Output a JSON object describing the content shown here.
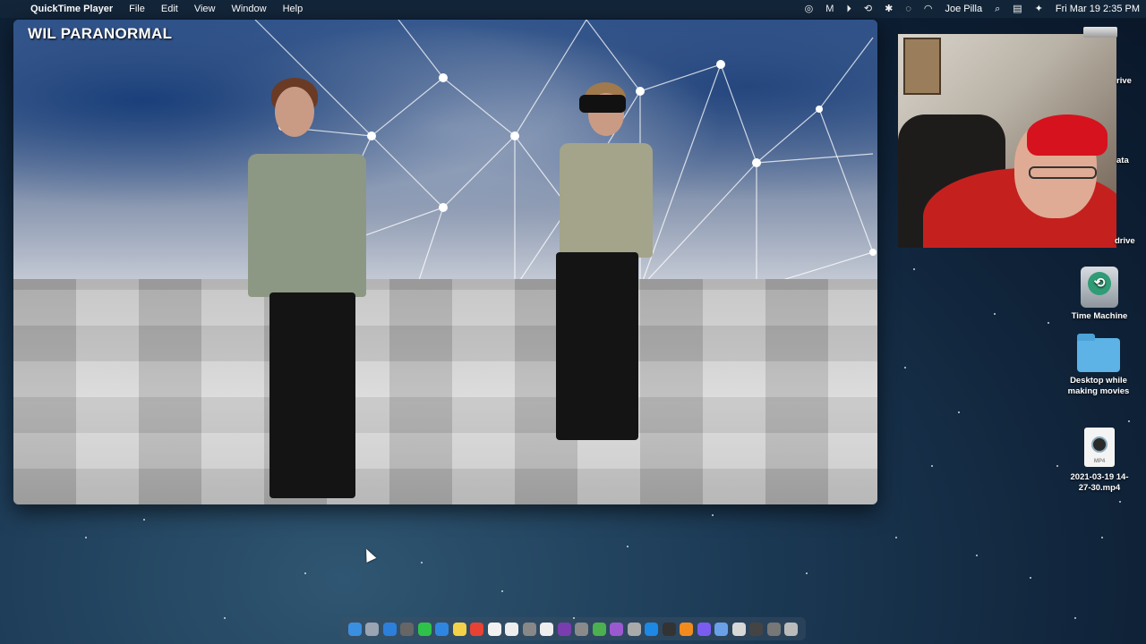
{
  "menubar": {
    "apple_glyph": "",
    "app_name": "QuickTime Player",
    "menus": [
      "File",
      "Edit",
      "View",
      "Window",
      "Help"
    ],
    "user_name": "Joe Pilla",
    "datetime": "Fri Mar 19  2:35 PM",
    "status_icons": [
      "creative-cloud-icon",
      "malwarebytes-icon",
      "play-icon",
      "time-machine-icon",
      "bluetooth-icon",
      "airdrop-icon",
      "wifi-icon",
      "search-icon",
      "control-center-icon",
      "siri-icon"
    ]
  },
  "video": {
    "watermark": "WIL PARANORMAL"
  },
  "desktop": {
    "edge_labels": [
      "rive",
      "ata",
      "drive"
    ],
    "items": [
      {
        "label": "Time Machine",
        "icon": "time-machine-disk-icon"
      },
      {
        "label": "Desktop while making movies",
        "icon": "folder-icon"
      },
      {
        "label": "2021-03-19 14-27-30.mp4",
        "icon": "mp4-file-icon",
        "badge": "MP4"
      }
    ]
  },
  "dock": {
    "icons": [
      "finder-icon",
      "launchpad-icon",
      "safari-icon",
      "screenshot-icon",
      "messages-icon",
      "mail-icon",
      "notes-icon",
      "chrome-icon",
      "calendar-icon",
      "reminders-icon",
      "calculator-icon",
      "textedit-icon",
      "photo-booth-icon",
      "system-prefs-icon",
      "preview-icon",
      "podcasts-icon",
      "archive-icon",
      "quicktime-icon",
      "clock-icon",
      "vlc-icon",
      "messenger-icon",
      "screen-share-icon",
      "folder-icon",
      "display-icon",
      "dock-misc-icon",
      "trash-icon"
    ],
    "colors": [
      "#3b8fe0",
      "#9aa4b2",
      "#2d7fdc",
      "#666",
      "#2fc24a",
      "#2f86e0",
      "#f3d24a",
      "#e84235",
      "#f2f2f2",
      "#ededed",
      "#888",
      "#eee",
      "#7a3db0",
      "#8a8a8a",
      "#4caf50",
      "#9b59d0",
      "#aaa",
      "#1e88e5",
      "#333",
      "#f28b1d",
      "#7b5cf0",
      "#6aa0e8",
      "#d7d7d7",
      "#444",
      "#777",
      "#bbb"
    ]
  }
}
